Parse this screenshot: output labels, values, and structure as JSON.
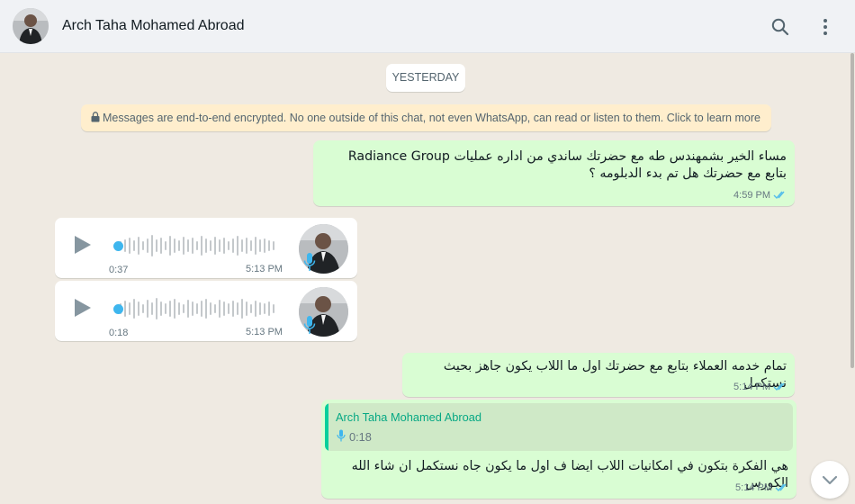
{
  "header": {
    "contact_name": "Arch Taha Mohamed Abroad"
  },
  "icons": {
    "search": "search-icon",
    "menu": "kebab-menu-icon",
    "lock": "lock-icon",
    "ticks": "double-check-icon",
    "play": "play-icon",
    "mic": "microphone-icon",
    "scroll_down": "chevron-down-icon"
  },
  "colors": {
    "outgoing_bubble": "#d9fdd3",
    "incoming_bubble": "#ffffff",
    "read_ticks": "#53bdeb",
    "voice_accent": "#3eb6ee",
    "quote_accent": "#06cf9c"
  },
  "chat": {
    "date_chip": "YESTERDAY",
    "encryption_notice": "Messages are end-to-end encrypted. No one outside of this chat, not even WhatsApp, can read or listen to them. Click to learn more",
    "messages": [
      {
        "direction": "out",
        "line1": "مساء الخير بشمهندس طه مع حضرتك ساندي من اداره عمليات Radiance Group",
        "line2": "بتابع مع حضرتك هل تم بدء الدبلومه ؟",
        "time": "4:59 PM"
      },
      {
        "direction": "in",
        "type": "voice",
        "duration": "0:37",
        "time": "5:13 PM"
      },
      {
        "direction": "in",
        "type": "voice",
        "duration": "0:18",
        "time": "5:13 PM"
      },
      {
        "direction": "out",
        "text": "تمام خدمه العملاء بتابع مع حضرتك اول ما اللاب يكون جاهز بحيث نستكمل",
        "time": "5:14 PM"
      },
      {
        "direction": "out",
        "quote_name": "Arch Taha Mohamed Abroad",
        "quote_duration": "0:18",
        "text": "هي الفكرة بتكون في امكانيات اللاب ايضا ف اول ما يكون جاه نستكمل ان شاء الله الكورس",
        "time": "5:14 PM"
      }
    ]
  }
}
